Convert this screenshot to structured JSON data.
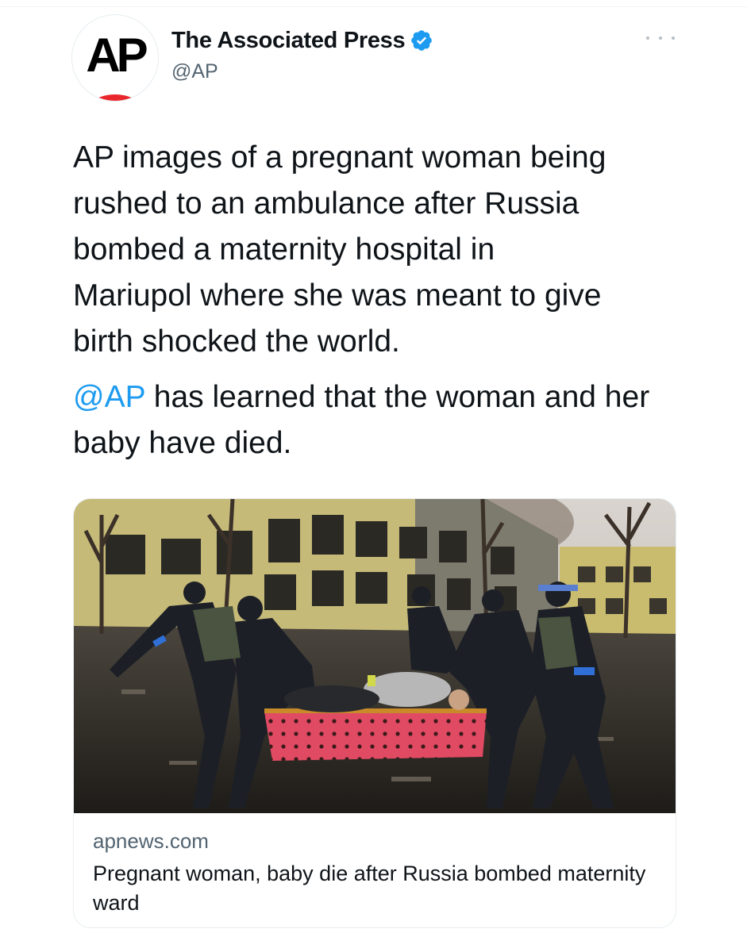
{
  "tweet": {
    "author": {
      "display_name": "The Associated Press",
      "handle": "@AP",
      "verified": true,
      "avatar_text": "AP"
    },
    "text_paragraph_1": "AP images of a pregnant woman being\nrushed to an ambulance after Russia\nbombed a maternity hospital in\nMariupol where she was meant to give\nbirth shocked the world.",
    "mention": "@AP",
    "text_paragraph_2_rest": " has learned that the woman and her baby have died.",
    "card": {
      "domain": "apnews.com",
      "title": "Pregnant woman, baby die after Russia bombed maternity ward"
    }
  },
  "colors": {
    "text_primary": "#0f1419",
    "text_secondary": "#536471",
    "link_blue": "#1d9bf0",
    "verified_blue": "#1d9bf0",
    "ap_red": "#e9262c"
  },
  "icons": {
    "verified": "verified-badge-icon",
    "more": "more-options-icon"
  }
}
